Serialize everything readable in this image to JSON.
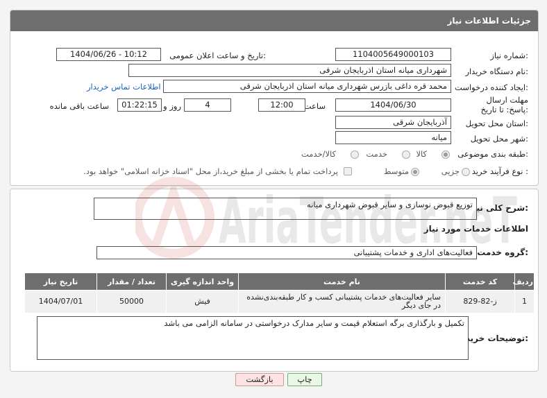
{
  "header": {
    "title": "جزئیات اطلاعات نیاز"
  },
  "form": {
    "need_number_label": "شماره نیاز:",
    "need_number": "1104005649000103",
    "announce_label": "تاریخ و ساعت اعلان عمومی:",
    "announce_value": "1404/06/26 - 10:12",
    "buyer_org_label": "نام دستگاه خریدار:",
    "buyer_org": "شهرداری میانه استان اذربایجان شرقی",
    "requester_label": "ایجاد کننده درخواست:",
    "requester": "محمد قره داغی بازرس شهرداری میانه استان اذربایجان شرقی",
    "contact_link": "اطلاعات تماس خریدار",
    "deadline_label": "مهلت ارسال پاسخ: تا تاریخ:",
    "deadline_date": "1404/06/30",
    "time_label": "ساعت",
    "deadline_time": "12:00",
    "days_value": "4",
    "days_label": "روز و",
    "remaining_time": "01:22:15",
    "remaining_label": "ساعت باقی مانده",
    "province_label": "استان محل تحویل:",
    "province": "آذربایجان شرقی",
    "city_label": "شهر محل تحویل:",
    "city": "میانه",
    "category_label": "طبقه بندی موضوعی:",
    "category_options": [
      "کالا",
      "خدمت",
      "کالا/خدمت"
    ],
    "process_label": "نوع فرآیند خرید :",
    "process_options": [
      "جزیی",
      "متوسط"
    ],
    "payment_note": "پرداخت تمام یا بخشی از مبلغ خرید،از محل \"اسناد خزانه اسلامی\" خواهد بود."
  },
  "details": {
    "summary_label": "شرح کلی نیاز:",
    "summary": "توزیع قبوض نوسازی و سایر قبوض شهرداری میانه",
    "services_title": "اطلاعات خدمات مورد نیاز",
    "service_group_label": "گروه خدمت:",
    "service_group": "فعالیت‌های اداری و خدمات پشتیبانی",
    "table": {
      "headers": [
        "ردیف",
        "کد خدمت",
        "نام خدمت",
        "واحد اندازه گیری",
        "تعداد / مقدار",
        "تاریخ نیاز"
      ],
      "rows": [
        [
          "1",
          "ز-82-829",
          "سایر فعالیت‌های خدمات پشتیبانی کسب و کار طبقه‌بندی‌نشده در جای دیگر",
          "فیش",
          "50000",
          "1404/07/01"
        ]
      ]
    },
    "buyer_notes_label": "توضیحات خریدار:",
    "buyer_notes": "تکمیل و بارگذاری برگه استعلام قیمت و سایر مدارک درخواستی در سامانه الزامی می باشد"
  },
  "buttons": {
    "print": "چاپ",
    "back": "بازگشت"
  },
  "colors": {
    "header_bg": "#6e6e6e",
    "link": "#1565c0",
    "back_btn_bg": "#fde3e3",
    "print_btn_bg": "#eaf6e6"
  },
  "watermark_text": "AriaTender.neT"
}
